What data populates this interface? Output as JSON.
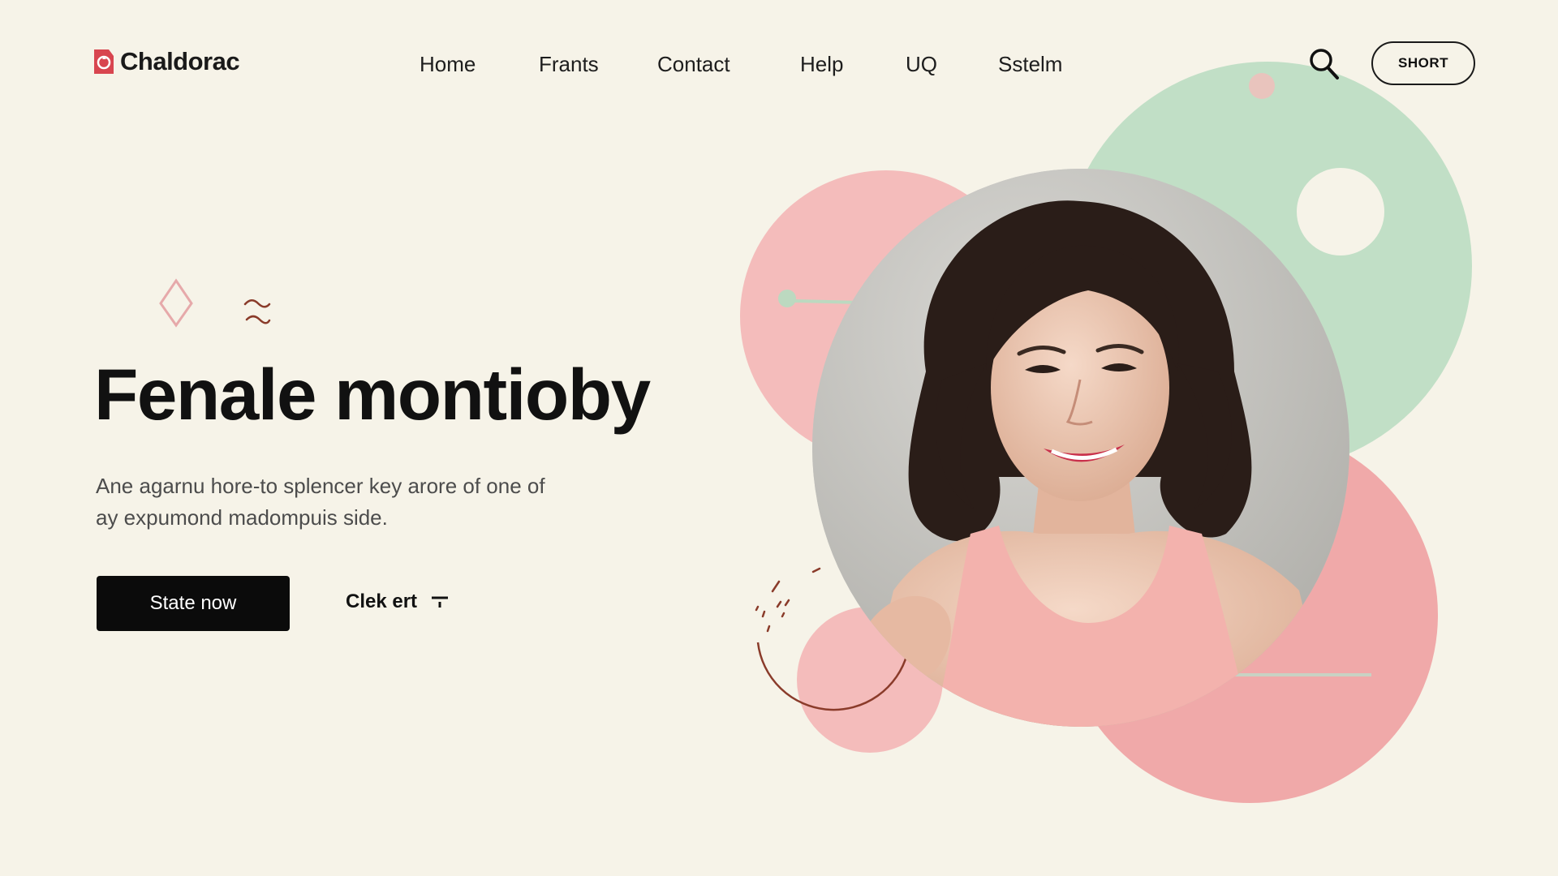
{
  "header": {
    "brand": "Chaldorac",
    "nav": [
      "Home",
      "Frants",
      "Contact",
      "Help",
      "UQ",
      "Sstelm"
    ],
    "cta_label": "SHORT"
  },
  "hero": {
    "title": "Fenale montioby",
    "subtitle_line1": "Ane agarnu hore-to splencer key arore of one of",
    "subtitle_line2": "ay expumond madompuis side.",
    "primary_label": "State now",
    "secondary_label": "Clek ert"
  },
  "icons": {
    "logo": "recycle-badge-icon",
    "search": "search-icon",
    "secondary": "filter-icon"
  },
  "colors": {
    "background": "#f6f3e8",
    "pink": "#f2b3b2",
    "pink_light": "#f4bcbb",
    "mint": "#c1dfc6",
    "dark": "#0b0b0b",
    "accent_brown": "#8a3b2a",
    "logo_red": "#d8454f"
  }
}
